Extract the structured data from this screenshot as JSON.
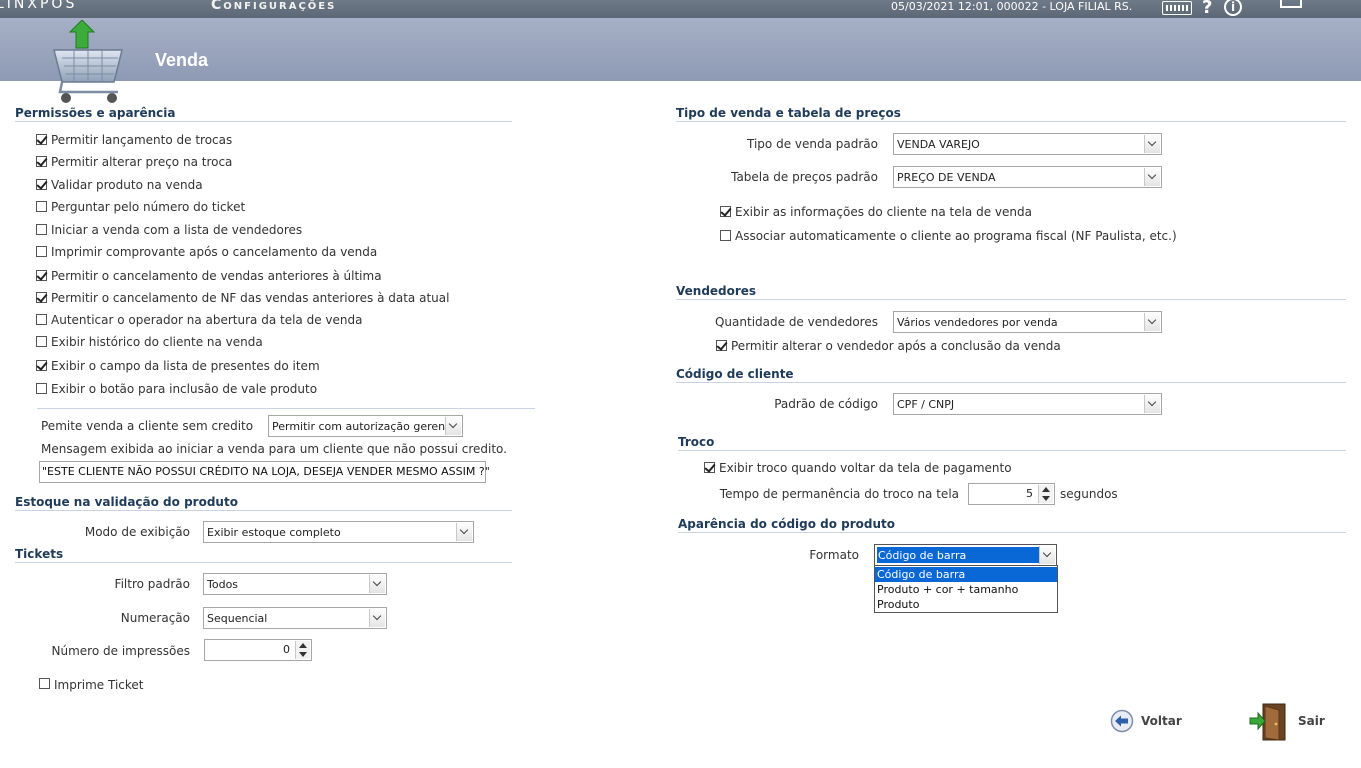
{
  "topbar": {
    "logo": "LINXPOS",
    "title": "Configurações",
    "status": "05/03/2021 12:01, 000022 - LOJA FILIAL RS.",
    "help": "?",
    "info": "i"
  },
  "header": {
    "title": "Venda"
  },
  "left": {
    "permissoes": {
      "title": "Permissões e aparência",
      "items": [
        {
          "label": "Permitir lançamento de trocas",
          "checked": true
        },
        {
          "label": "Permitir alterar preço na troca",
          "checked": true
        },
        {
          "label": "Validar produto na venda",
          "checked": true
        },
        {
          "label": "Perguntar pelo número do ticket",
          "checked": false
        },
        {
          "label": "Iniciar a venda com a lista de vendedores",
          "checked": false
        },
        {
          "label": "Imprimir comprovante após o cancelamento da venda",
          "checked": false
        },
        {
          "label": "Permitir o cancelamento de vendas anteriores à última",
          "checked": true
        },
        {
          "label": "Permitir o cancelamento de NF das vendas anteriores à data atual",
          "checked": true
        },
        {
          "label": "Autenticar o operador na abertura da tela de venda",
          "checked": false
        },
        {
          "label": "Exibir histórico do cliente na venda",
          "checked": false
        },
        {
          "label": "Exibir o campo da lista de presentes do item",
          "checked": true
        },
        {
          "label": "Exibir o botão para inclusão de vale produto",
          "checked": false
        }
      ]
    },
    "credito": {
      "label": "Pemite venda a cliente sem credito",
      "value": "Permitir com autorização gerente",
      "msg_label": "Mensagem exibida ao iniciar a venda para um cliente que não possui credito.",
      "msg_value": "\"ESTE CLIENTE NÃO POSSUI CRÉDITO NA LOJA, DESEJA VENDER MESMO ASSIM ?\""
    },
    "estoque": {
      "title": "Estoque na validação do produto",
      "modo_label": "Modo de exibição",
      "modo_value": "Exibir estoque completo"
    },
    "tickets": {
      "title": "Tickets",
      "filtro_label": "Filtro padrão",
      "filtro_value": "Todos",
      "numeracao_label": "Numeração",
      "numeracao_value": "Sequencial",
      "impressoes_label": "Número de impressões",
      "impressoes_value": "0",
      "imprime_label": "Imprime Ticket",
      "imprime_checked": false
    }
  },
  "right": {
    "tipo": {
      "title": "Tipo de venda e tabela de preços",
      "tipo_label": "Tipo de venda padrão",
      "tipo_value": "VENDA VAREJO",
      "tabela_label": "Tabela de preços padrão",
      "tabela_value": "PREÇO DE VENDA",
      "exibir_label": "Exibir as informações do cliente na tela de venda",
      "exibir_checked": true,
      "associar_label": "Associar automaticamente o cliente ao programa fiscal (NF Paulista, etc.)",
      "associar_checked": false
    },
    "vendedores": {
      "title": "Vendedores",
      "qtd_label": "Quantidade de vendedores",
      "qtd_value": "Vários vendedores por venda",
      "alterar_label": "Permitir alterar o vendedor após a conclusão da venda",
      "alterar_checked": true
    },
    "cliente": {
      "title": "Código de cliente",
      "padrao_label": "Padrão de código",
      "padrao_value": "CPF / CNPJ"
    },
    "troco": {
      "title": "Troco",
      "exibir_label": "Exibir troco quando voltar da tela de pagamento",
      "exibir_checked": true,
      "tempo_label": "Tempo de permanência do troco na tela",
      "tempo_value": "5",
      "tempo_unit": "segundos"
    },
    "aparencia": {
      "title": "Aparência do código do produto",
      "formato_label": "Formato",
      "formato_value": "Código de barra",
      "options": [
        "Código de barra",
        "Produto + cor + tamanho",
        "Produto"
      ]
    }
  },
  "footer": {
    "voltar": "Voltar",
    "sair": "Sair"
  },
  "colors": {
    "accent": "#0a67d6",
    "header": "#98a3bc",
    "section_text": "#1f3b5a"
  }
}
